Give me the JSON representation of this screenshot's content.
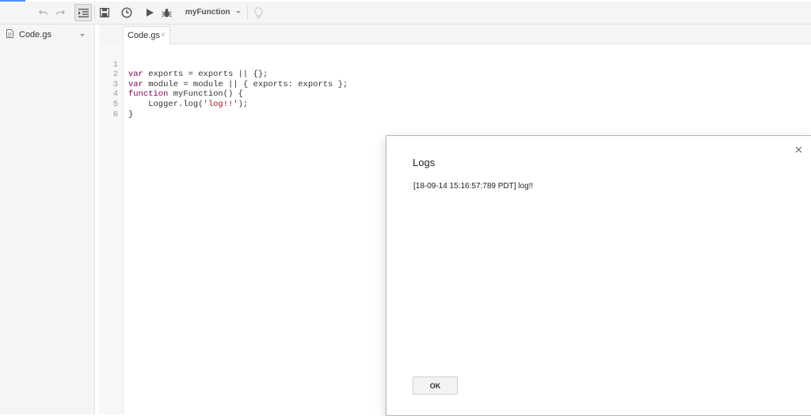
{
  "toolbar": {
    "function_select": "myFunction",
    "icons": [
      "undo-icon",
      "redo-icon",
      "indent-icon",
      "save-icon",
      "clock-icon",
      "run-icon",
      "debug-icon",
      "lightbulb-icon"
    ]
  },
  "sidebar": {
    "files": [
      {
        "label": "Code.gs"
      }
    ]
  },
  "editor": {
    "tab_label": "Code.gs",
    "tab_close": "×",
    "lines": [
      {
        "num": "1",
        "text": "var exports = exports || {};"
      },
      {
        "num": "2",
        "text": "var module = module || { exports: exports };"
      },
      {
        "num": "3",
        "text": "function myFunction() {"
      },
      {
        "num": "4",
        "text": "    Logger.log('log!!');"
      },
      {
        "num": "5",
        "text": "}"
      },
      {
        "num": "6",
        "text": ""
      }
    ]
  },
  "dialog": {
    "title": "Logs",
    "close": "✕",
    "log_entry": "[18-09-14 15:16:57:789 PDT] log!!",
    "ok_label": "OK"
  },
  "colors": {
    "accent": "#4d90fe",
    "keyword": "#7f0055",
    "string": "#a31515"
  }
}
